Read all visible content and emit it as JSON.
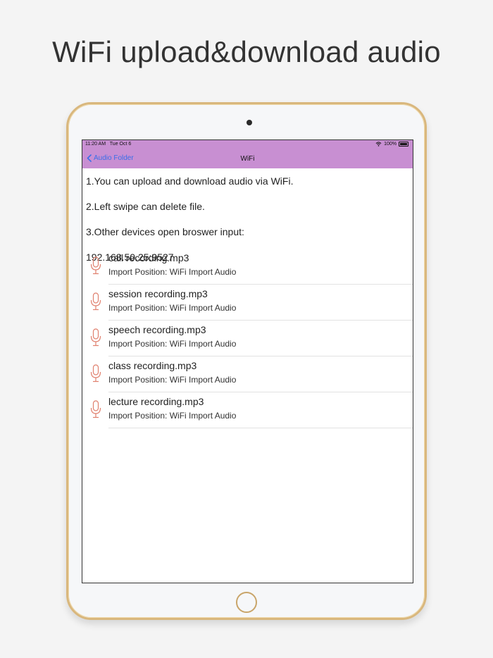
{
  "headline": "WiFi upload&download audio",
  "status": {
    "time": "11:20 AM",
    "date": "Tue Oct 6",
    "battery": "100%"
  },
  "nav": {
    "back_label": "Audio Folder",
    "title": "WiFi"
  },
  "info": [
    "1.You can upload and download audio via WiFi.",
    "2.Left swipe can delete file.",
    "3.Other devices open broswer input:",
    "192.168.50.25:9527"
  ],
  "files": [
    {
      "name": "call recording.mp3",
      "position": "Import Position: WiFi Import Audio"
    },
    {
      "name": "session recording.mp3",
      "position": "Import Position: WiFi Import Audio"
    },
    {
      "name": "speech recording.mp3",
      "position": "Import Position: WiFi Import Audio"
    },
    {
      "name": "class recording.mp3",
      "position": "Import Position: WiFi Import Audio"
    },
    {
      "name": "lecture recording.mp3",
      "position": "Import Position: WiFi Import Audio"
    }
  ],
  "colors": {
    "bar": "#c88fd2",
    "link": "#3a6ee8",
    "mic": "#e0806e",
    "device_frame": "#d9b77d"
  },
  "icons": {
    "back": "chevron-left-icon",
    "file": "microphone-icon",
    "wifi": "wifi-icon",
    "battery": "battery-icon"
  }
}
